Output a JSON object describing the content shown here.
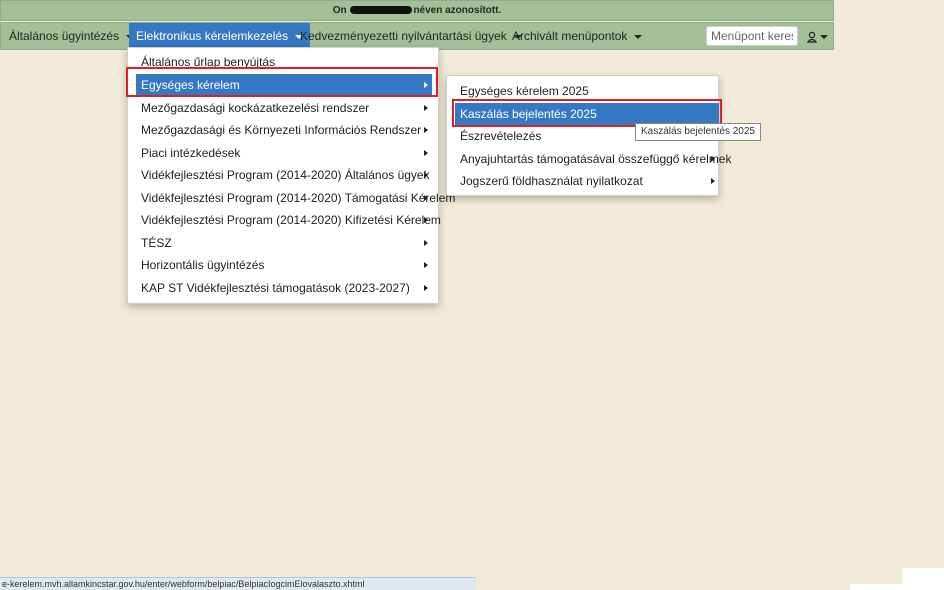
{
  "banner": {
    "prefix": "On",
    "suffix": "néven azonosított."
  },
  "nav": {
    "items": [
      {
        "label": "Általános ügyintézés"
      },
      {
        "label": "Elektronikus kérelemkezelés"
      },
      {
        "label": "Kedvezményezetti nyilvántartási ügyek"
      },
      {
        "label": "Archivált menüpontok"
      }
    ],
    "search_placeholder": "Menüpont kereső",
    "user_icon": "user-icon"
  },
  "menu1": {
    "items": [
      {
        "label": "Általános űrlap benyújtás"
      },
      {
        "label": "Egységes kérelem"
      },
      {
        "label": "Mezőgazdasági kockázatkezelési rendszer"
      },
      {
        "label": "Mezőgazdasági és Környezeti Információs Rendszer"
      },
      {
        "label": "Piaci intézkedések"
      },
      {
        "label": "Vidékfejlesztési Program (2014-2020) Általános ügyek"
      },
      {
        "label": "Vidékfejlesztési Program (2014-2020) Támogatási Kérelem"
      },
      {
        "label": "Vidékfejlesztési Program (2014-2020) Kifizetési Kérelem"
      },
      {
        "label": "TÉSZ"
      },
      {
        "label": "Horizontális ügyintézés"
      },
      {
        "label": "KAP ST Vidékfejlesztési támogatások (2023-2027)"
      }
    ]
  },
  "menu2": {
    "items": [
      {
        "label": "Egységes kérelem 2025"
      },
      {
        "label": "Kaszálás bejelentés 2025"
      },
      {
        "label": "Észrevételezés"
      },
      {
        "label": "Anyajuhtartás támogatásával összefüggő kérelmek"
      },
      {
        "label": "Jogszerű földhasználat nyilatkozat"
      }
    ]
  },
  "tooltip": "Kaszálás bejelentés 2025",
  "status_url": "e-kerelem.mvh.allamkincstar.gov.hu/enter/webform/belpiac/BelpiacIogcimElovalaszto.xhtml",
  "colors": {
    "menubar": "#a3bf98",
    "active": "#3578c4",
    "background": "#f2ead8",
    "highlight_box": "#d22222"
  }
}
